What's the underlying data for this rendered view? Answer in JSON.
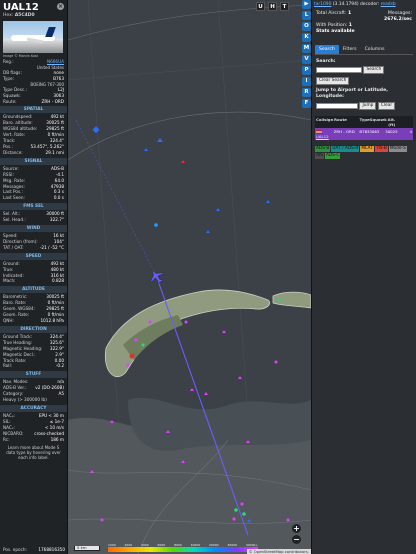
{
  "aircraft": {
    "callsign": "UAL12",
    "hex_label": "Hex:",
    "hex": "A5C4D0",
    "close_glyph": "×",
    "image_credit": "Image © Marvin Kost",
    "registration_block": [
      {
        "k": "Reg.:",
        "v": "N666UA",
        "link": true
      },
      {
        "k": "",
        "v": "United States"
      },
      {
        "k": "DB flags:",
        "v": "none"
      },
      {
        "k": "Type:",
        "v": "B763"
      },
      {
        "k": "",
        "v": "BOEING 767-300"
      },
      {
        "k": "Type Desc.:",
        "v": "L2J"
      },
      {
        "k": "Squawk:",
        "v": "3063"
      },
      {
        "k": "Route:",
        "v": "ZRH - ORD"
      }
    ],
    "sections": [
      {
        "title": "SPATIAL",
        "rows": [
          {
            "k": "Groundspeed:",
            "v": "492 kt"
          },
          {
            "k": "Baro. altitude:",
            "v": "30025 ft"
          },
          {
            "k": "WGS84 altitude:",
            "v": "29825 ft"
          },
          {
            "k": "Vert. Rate:",
            "v": "0 ft/min"
          },
          {
            "k": "Track:",
            "v": "324.4°"
          },
          {
            "k": "Pos.:",
            "v": "53.457°, 5.262°"
          },
          {
            "k": "Distance:",
            "v": "29.1 nmi"
          }
        ]
      },
      {
        "title": "SIGNAL",
        "rows": [
          {
            "k": "Source:",
            "v": "ADS-B"
          },
          {
            "k": "RSSI:",
            "v": "-4.1"
          },
          {
            "k": "Msg. Rate:",
            "v": "64.0"
          },
          {
            "k": "Messages:",
            "v": "47938"
          },
          {
            "k": "Last Pos.:",
            "v": "0.3 s"
          },
          {
            "k": "Last Seen:",
            "v": "0.0 s"
          }
        ]
      },
      {
        "title": "FMS SEL",
        "rows": [
          {
            "k": "Sel. Alt.:",
            "v": "30000 ft"
          },
          {
            "k": "Sel. Head.:",
            "v": "322.7°"
          }
        ]
      },
      {
        "title": "WIND",
        "rows": [
          {
            "k": "Speed:",
            "v": "16 kt"
          },
          {
            "k": "Direction (from):",
            "v": "104°"
          },
          {
            "k": "TAT / OAT:",
            "v": "-21 / -52 °C"
          }
        ]
      },
      {
        "title": "SPEED",
        "rows": [
          {
            "k": "Ground:",
            "v": "492 kt"
          },
          {
            "k": "True:",
            "v": "480 kt"
          },
          {
            "k": "Indicated:",
            "v": "316 kt"
          },
          {
            "k": "Mach:",
            "v": "0.828"
          }
        ]
      },
      {
        "title": "ALTITUDE",
        "rows": [
          {
            "k": "Barometric:",
            "v": "30025 ft"
          },
          {
            "k": "Baro. Rate:",
            "v": "0 ft/min"
          },
          {
            "k": "Geom. WGS84:",
            "v": "29825 ft"
          },
          {
            "k": "Geom. Rate:",
            "v": "0 ft/min"
          },
          {
            "k": "QNH:",
            "v": "1012.8 hPa"
          }
        ]
      },
      {
        "title": "DIRECTION",
        "rows": [
          {
            "k": "Ground Track:",
            "v": "324.4°"
          },
          {
            "k": "True Heading:",
            "v": "325.6°"
          },
          {
            "k": "Magnetic Heading:",
            "v": "322.9°"
          },
          {
            "k": "Magnetic Decl.:",
            "v": "2.9°"
          },
          {
            "k": "Track Rate:",
            "v": "0.00"
          },
          {
            "k": "Roll:",
            "v": "-0.2"
          }
        ]
      },
      {
        "title": "STUFF",
        "rows": [
          {
            "k": "Nav. Modes:",
            "v": "n/a"
          },
          {
            "k": "ADS-B Ver.:",
            "v": "v2 (DO-260B)"
          },
          {
            "k": "Category:",
            "v": "A5"
          },
          {
            "k": "Heavy (> 300000 lb)",
            "v": ""
          }
        ]
      },
      {
        "title": "ACCURACY",
        "rows": [
          {
            "k": "NACₚ:",
            "v": "EPU < 30 m"
          },
          {
            "k": "SIL:",
            "v": "≤ 1e-7"
          },
          {
            "k": "NACᵥ:",
            "v": "< 10 m/s"
          },
          {
            "k": "NICBARO:",
            "v": "cross-checked"
          },
          {
            "k": "Rc:",
            "v": "186 m"
          }
        ]
      }
    ],
    "help_note": "Learn more about Mode S data type by hovering over each info label.",
    "epoch_label": "Pos. epoch:",
    "epoch_value": "1768816350"
  },
  "map_buttons": [
    "U",
    "H",
    "T"
  ],
  "strip_buttons": [
    "▶",
    "L",
    "O",
    "K",
    "M",
    "V",
    "P",
    "I",
    "R",
    "F"
  ],
  "map": {
    "zoom_in": "+",
    "zoom_out": "−",
    "attribution": "© OpenStreetMap contributors.",
    "scale": "5 km",
    "alt_ticks": [
      "1000",
      "2000",
      "4000",
      "6000",
      "8000",
      "10000",
      "20000",
      "30000",
      "40000+"
    ]
  },
  "sidebar": {
    "version_prefix": "tar1090",
    "version": "(3.14.1794)",
    "decoder_label": "decoder:",
    "decoder": "readsb",
    "total_label": "Total Aircraft:",
    "total_value": "1",
    "messages_label": "Messages:",
    "messages_value": "2676.2/sec",
    "with_pos_label": "With Position:",
    "with_pos_value": "1",
    "stats_label": "Stats available",
    "tabs": [
      "Search",
      "Filters",
      "Columns"
    ],
    "search_label": "Search:",
    "search_btn": "Search",
    "clear_search_btn": "Clear Search",
    "jump_label": "Jump to Airport or Latitude, Longitude:",
    "jump_btn": "Jump",
    "clear_btn": "Clear",
    "columns": [
      "Callsign",
      "Route",
      "Type",
      "Squawk",
      "Alt. (ft)",
      ""
    ],
    "rows": [
      {
        "callsign": "UAL12",
        "route": "ZRH - ORD",
        "type": "B763",
        "squawk": "3063",
        "alt": "30025",
        "extra": "4"
      }
    ],
    "sources": [
      {
        "label": "ADS-B",
        "color": "#2f8f3f"
      },
      {
        "label": "UAT / ADS-R",
        "color": "#1c8a8a"
      },
      {
        "label": "MLAT",
        "color": "#e39b2c"
      },
      {
        "label": "TIS-B",
        "color": "#d9443b"
      },
      {
        "label": "Mode-S",
        "color": "#8c8c8c"
      },
      {
        "label": "AIS",
        "color": "#4d4d4d"
      },
      {
        "label": "ADS-C",
        "color": "#3b9a3b"
      }
    ]
  },
  "colors": {
    "accent": "#2a7dd4",
    "selected_row": "#7a3fb8",
    "track_line": "#6b5cff"
  }
}
